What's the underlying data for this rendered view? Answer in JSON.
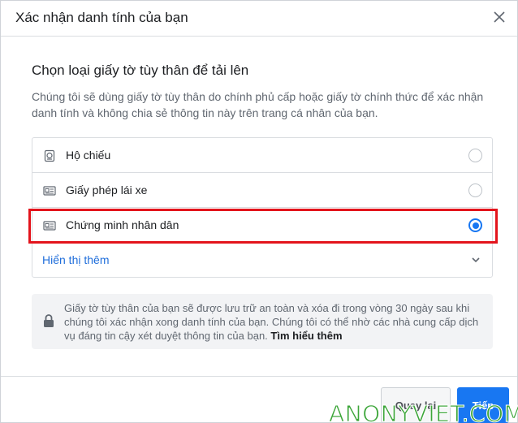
{
  "header": {
    "title": "Xác nhận danh tính của bạn",
    "close_icon": "close-icon"
  },
  "content": {
    "title": "Chọn loại giấy tờ tùy thân để tải lên",
    "description": "Chúng tôi sẽ dùng giấy tờ tùy thân do chính phủ cấp hoặc giấy tờ chính thức để xác nhận danh tính và không chia sẻ thông tin này trên trang cá nhân của bạn."
  },
  "options": [
    {
      "label": "Hộ chiếu",
      "icon": "passport-icon",
      "selected": false
    },
    {
      "label": "Giấy phép lái xe",
      "icon": "id-card-icon",
      "selected": false
    },
    {
      "label": "Chứng minh nhân dân",
      "icon": "id-card-icon",
      "selected": true
    }
  ],
  "show_more": {
    "label": "Hiển thị thêm",
    "icon": "chevron-down-icon"
  },
  "notice": {
    "text": "Giấy tờ tùy thân của bạn sẽ được lưu trữ an toàn và xóa đi trong vòng 30 ngày sau khi chúng tôi xác nhận xong danh tính của bạn. Chúng tôi có thể nhờ các nhà cung cấp dịch vụ đáng tin cậy xét duyệt thông tin của bạn.",
    "link": "Tìm hiểu thêm",
    "icon": "lock-icon"
  },
  "footer": {
    "back_label": "Quay lại",
    "next_label": "Tiếp"
  },
  "watermark": "ANONYVIET.COM",
  "colors": {
    "accent": "#1877f2",
    "highlight": "#e3141c",
    "link": "#216fdb"
  }
}
